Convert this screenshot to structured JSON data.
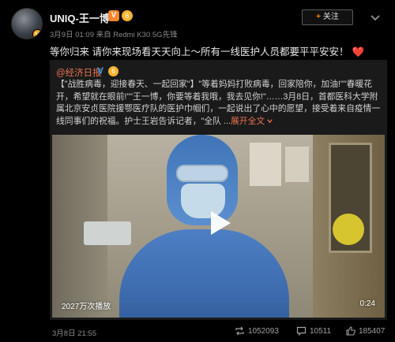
{
  "post": {
    "username": "UNIQ-王一博",
    "vip_badge": "V",
    "level_badge": "6",
    "meta": "3月9日 01:09 来自 Redmi K30 5G先锋",
    "follow_label": "关注",
    "text": "等你归来 请你来现场看天天向上～所有一线医护人员都要平平安安！",
    "heart": "❤️"
  },
  "repost": {
    "author": "@经济日报",
    "verified_icon": "V",
    "level_badge": "6",
    "text": "【\"战胜病毒，迎接春天、一起回家\"】\"等着妈妈打败病毒，回家陪你，加油!\"\"春暖花开，希望就在眼前!\"\"王一博，你要等着我哦，我去见你!\"……3月8日，首都医科大学附属北京安贞医院援鄂医疗队的医护巾帼们，一起说出了心中的愿望，接受着来自疫情一线同事们的祝福。护士王岩告诉记者，\"全队 ...",
    "fold_label": "展开全文",
    "fold_icon": "chevron-down-icon",
    "video": {
      "play_count": "2027万次播放",
      "duration": "0:24"
    }
  },
  "footer": {
    "date": "3月8日 21:55",
    "repost_count": "1052093",
    "comment_count": "10511",
    "like_count": "185407"
  },
  "colors": {
    "accent": "#eb7350",
    "follow_plus": "#ff8200",
    "vip": "#f3862f",
    "background": "#000000"
  }
}
